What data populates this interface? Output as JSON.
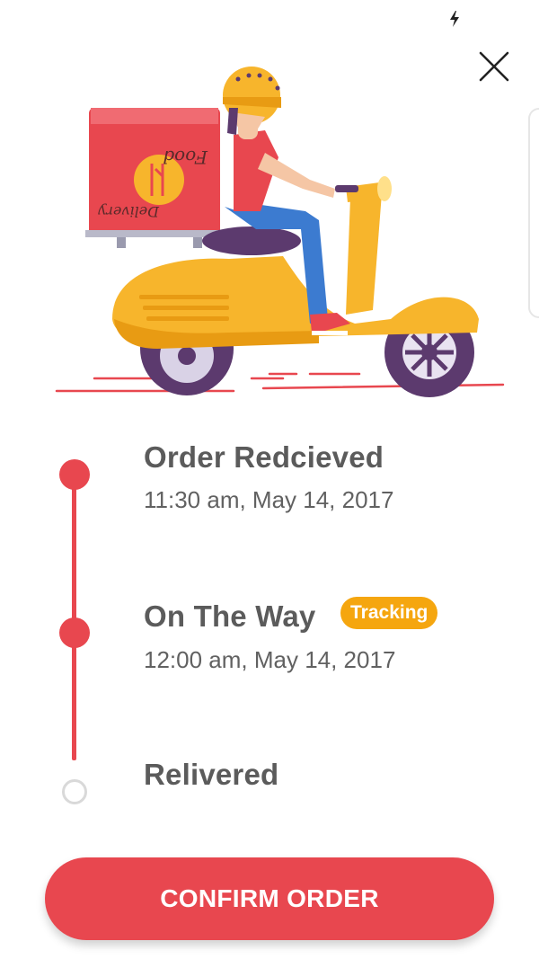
{
  "header": {
    "close_icon": "close-icon",
    "status_icon": "charging-bolt-icon"
  },
  "illustration": {
    "box_text_line1": "Food",
    "box_text_line2": "Delivery"
  },
  "timeline": {
    "steps": [
      {
        "title": "Order Redcieved",
        "time": "11:30 am, May 14, 2017",
        "state": "done"
      },
      {
        "title": "On The Way",
        "time": "12:00 am, May 14, 2017",
        "state": "done",
        "badge": "Tracking"
      },
      {
        "title": "Relivered",
        "time": "",
        "state": "pending"
      }
    ]
  },
  "actions": {
    "confirm_label": "CONFIRM ORDER"
  },
  "colors": {
    "accent": "#e8474f",
    "badge": "#f5a60f",
    "text": "#5b5b5b"
  }
}
